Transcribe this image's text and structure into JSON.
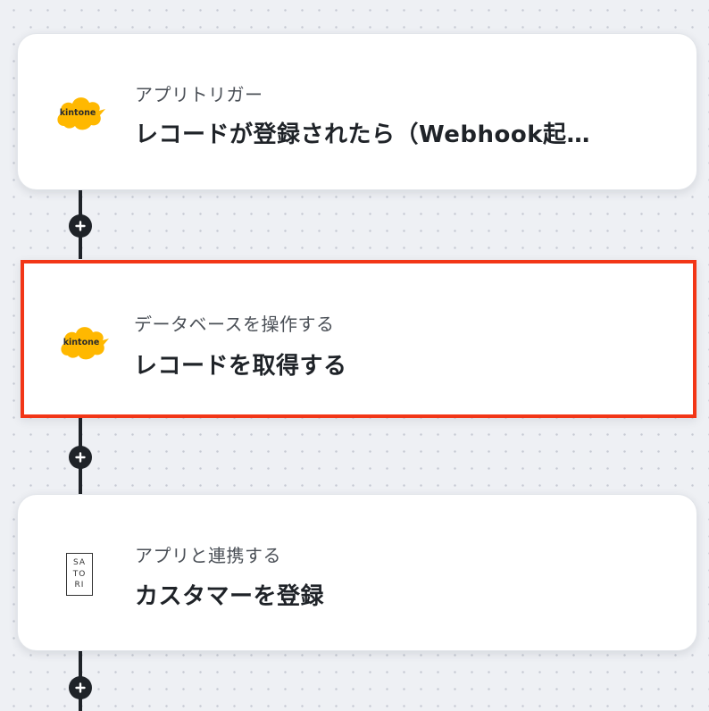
{
  "flow": {
    "steps": [
      {
        "app": "kintone",
        "app_logo_text": "kintone",
        "subtitle": "アプリトリガー",
        "title": "レコードが登録されたら（Webhook起…",
        "selected": false
      },
      {
        "app": "kintone",
        "app_logo_text": "kintone",
        "subtitle": "データベースを操作する",
        "title": "レコードを取得する",
        "selected": true
      },
      {
        "app": "SATORI",
        "app_logo_lines": [
          "SA",
          "TO",
          "RI"
        ],
        "subtitle": "アプリと連携する",
        "title": "カスタマーを登録",
        "selected": false
      }
    ],
    "add_step_icon": "plus-icon"
  },
  "colors": {
    "kintone_yellow": "#ffb800",
    "selection_red": "#f23617",
    "connector": "#1f2328"
  }
}
